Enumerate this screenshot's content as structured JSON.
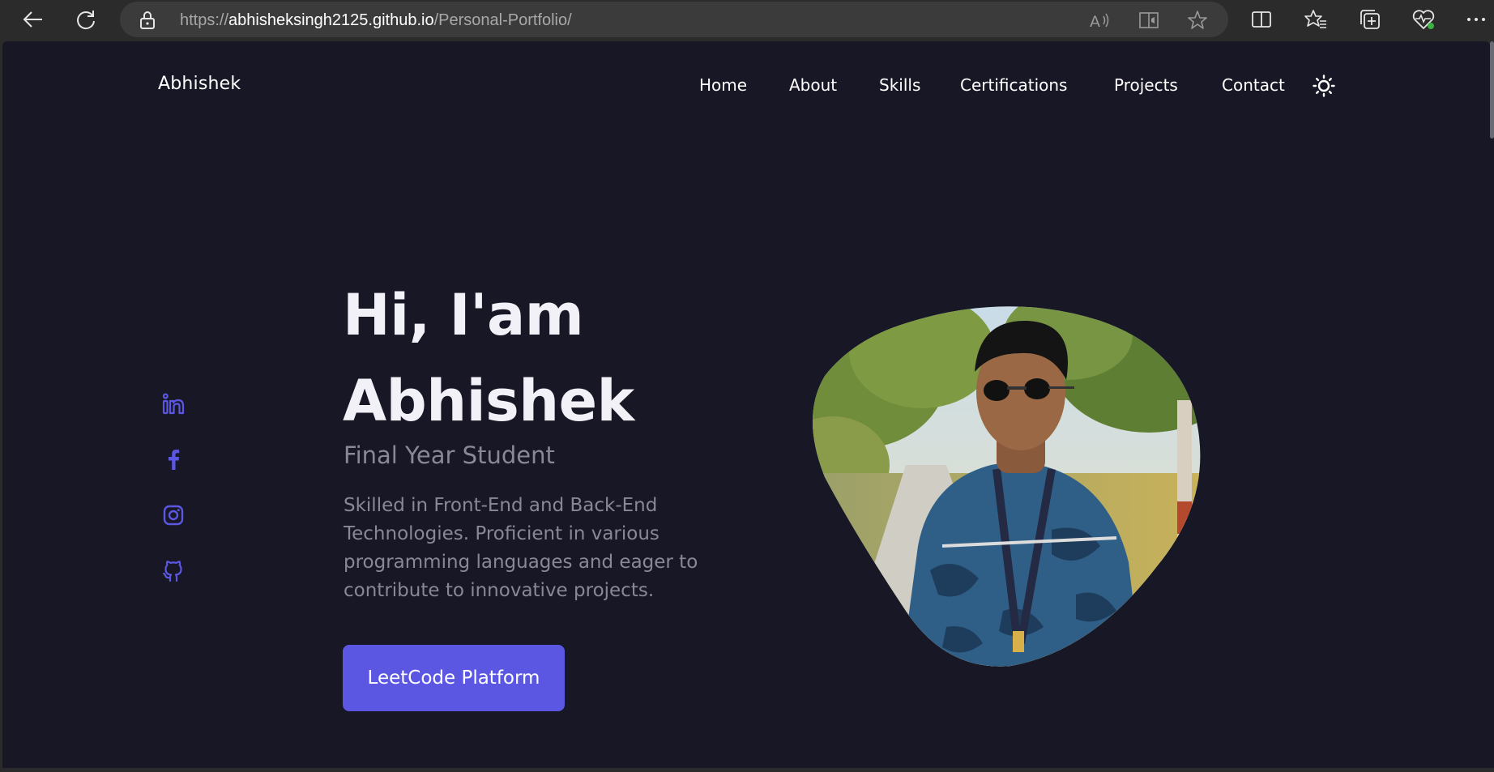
{
  "browser": {
    "url_scheme": "https://",
    "url_host": "abhisheksingh2125.github.io",
    "url_path": "/Personal-Portfolio/",
    "icons": [
      "back-icon",
      "refresh-icon",
      "lock-icon",
      "read-aloud-icon",
      "immersive-reader-icon",
      "favorite-star-icon",
      "split-screen-icon",
      "favorites-icon",
      "collections-icon",
      "browser-essentials-icon",
      "more-icon"
    ]
  },
  "nav": {
    "brand": "Abhishek",
    "items": [
      "Home",
      "About",
      "Skills",
      "Certifications",
      "Projects",
      "Contact"
    ],
    "theme_icon": "sun-icon"
  },
  "social": [
    "linkedin-icon",
    "facebook-icon",
    "instagram-icon",
    "github-icon"
  ],
  "hero": {
    "greeting": "Hi, I'am",
    "name": "Abhishek",
    "subtitle": "Final Year Student",
    "description": "Skilled in Front-End and Back-End Technologies. Proficient in various programming languages and eager to contribute to innovative projects.",
    "cta": "LeetCode Platform",
    "photo": "profile-photo"
  },
  "colors": {
    "background": "#181725",
    "accent": "#5b57e3",
    "text": "#ffffff",
    "muted": "#898896"
  }
}
